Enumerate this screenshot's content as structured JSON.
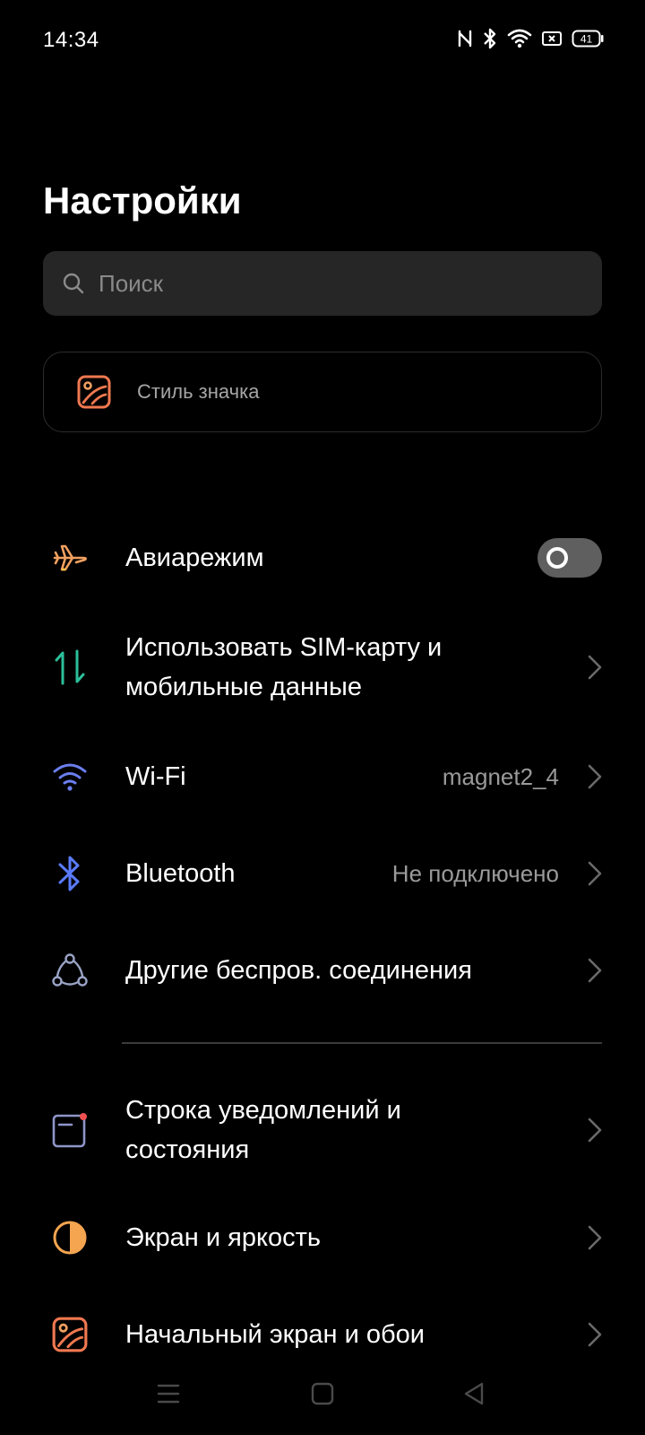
{
  "status_bar": {
    "time": "14:34",
    "battery": "41",
    "icons": [
      "nfc-icon",
      "bluetooth-icon",
      "wifi-icon",
      "sim-icon",
      "battery-icon"
    ]
  },
  "header": {
    "title": "Настройки"
  },
  "search": {
    "placeholder": "Поиск"
  },
  "style_card": {
    "label": "Стиль значка",
    "icon": "wallpaper-icon"
  },
  "settings": [
    {
      "label": "Авиарежим",
      "icon": "airplane-icon",
      "control": "toggle",
      "toggle_on": false,
      "color": "#f0a060"
    },
    {
      "label_line1": "Использовать SIM-карту и",
      "label_line2": "мобильные данные",
      "icon": "data-transfer-icon",
      "color": "#2bbf9a"
    },
    {
      "label": "Wi-Fi",
      "value": "magnet2_4",
      "icon": "wifi-icon",
      "color": "#6b7ef0"
    },
    {
      "label": "Bluetooth",
      "value": "Не подключено",
      "icon": "bluetooth-icon",
      "color": "#5b7bff"
    },
    {
      "label": "Другие беспров. соединения",
      "icon": "connections-icon",
      "color": "#9aa4c6"
    },
    {
      "label_line1": "Строка уведомлений и",
      "label_line2": "состояния",
      "icon": "notification-icon",
      "color": "#8e95c8"
    },
    {
      "label": "Экран и яркость",
      "icon": "brightness-icon",
      "color": "#f5a550"
    },
    {
      "label": "Начальный экран и обои",
      "icon": "wallpaper-icon",
      "color": "#f07850"
    }
  ],
  "nav_bar": {
    "icons": [
      "menu-icon",
      "home-icon",
      "back-icon"
    ]
  }
}
